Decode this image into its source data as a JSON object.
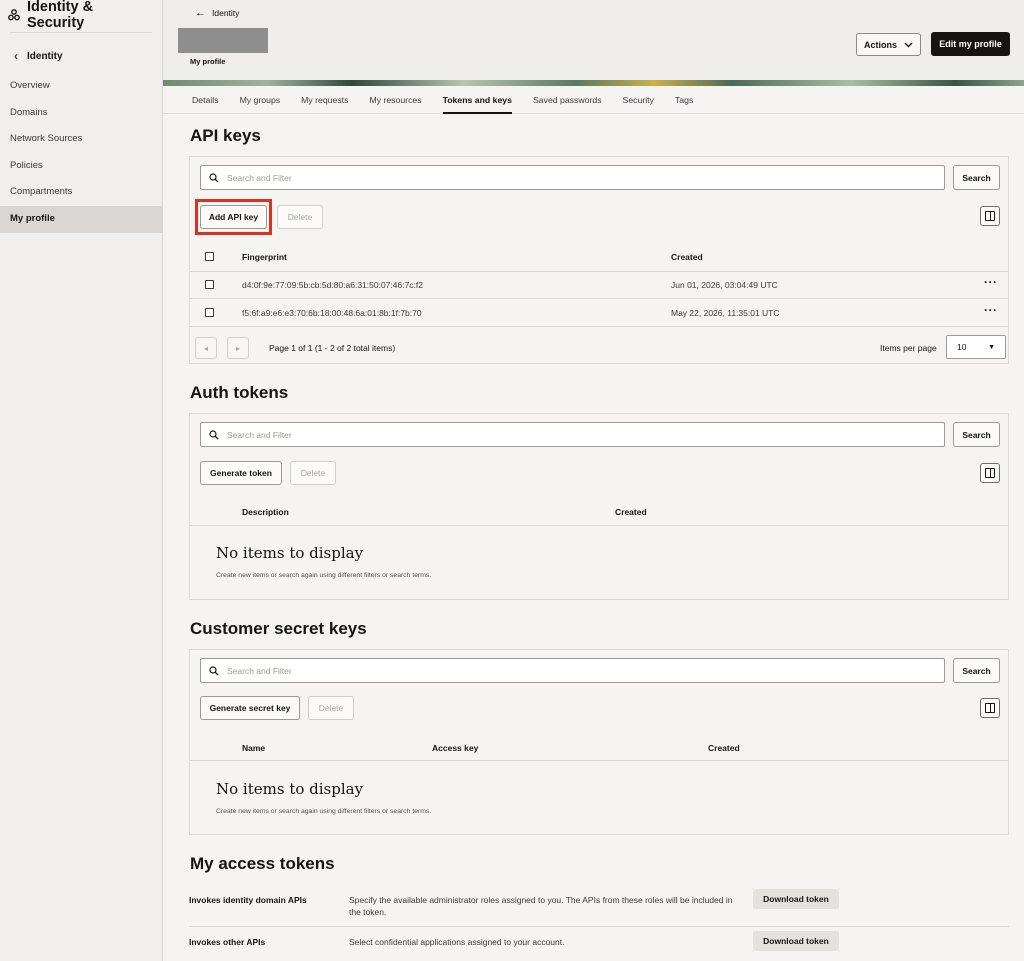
{
  "sidebar": {
    "app_title": "Identity & Security",
    "back_label": "Identity",
    "items": [
      {
        "label": "Overview"
      },
      {
        "label": "Domains"
      },
      {
        "label": "Network Sources"
      },
      {
        "label": "Policies"
      },
      {
        "label": "Compartments"
      },
      {
        "label": "My profile",
        "active": true
      }
    ]
  },
  "header": {
    "back_link": "Identity",
    "profile_label": "My profile",
    "actions_label": "Actions",
    "edit_label": "Edit my profile"
  },
  "tabs": [
    {
      "label": "Details"
    },
    {
      "label": "My groups"
    },
    {
      "label": "My requests"
    },
    {
      "label": "My resources"
    },
    {
      "label": "Tokens and keys",
      "active": true
    },
    {
      "label": "Saved passwords"
    },
    {
      "label": "Security"
    },
    {
      "label": "Tags"
    }
  ],
  "api_keys": {
    "title": "API keys",
    "search_placeholder": "Search and Filter",
    "search_label": "Search",
    "add_label": "Add API key",
    "delete_label": "Delete",
    "columns": {
      "fingerprint": "Fingerprint",
      "created": "Created"
    },
    "rows": [
      {
        "fingerprint": "d4:0f:9e:77:09:5b:cb:5d:80:a6:31:50:07:46:7c:f2",
        "created": "Jun 01, 2026, 03:04:49 UTC"
      },
      {
        "fingerprint": "f5:6f:a9:e6:e3:70:6b:18:00:48:6a:01:8b:1f:7b:70",
        "created": "May 22, 2026, 11:35:01 UTC"
      }
    ],
    "pager_text": "Page 1 of 1 (1 - 2 of 2 total items)",
    "items_per_page_label": "Items per page",
    "items_per_page_value": "10"
  },
  "auth_tokens": {
    "title": "Auth tokens",
    "search_placeholder": "Search and Filter",
    "search_label": "Search",
    "generate_label": "Generate token",
    "delete_label": "Delete",
    "columns": {
      "description": "Description",
      "created": "Created"
    },
    "empty_title": "No items to display",
    "empty_sub": "Create new items or search again using different filters or search terms."
  },
  "secret_keys": {
    "title": "Customer secret keys",
    "search_placeholder": "Search and Filter",
    "search_label": "Search",
    "generate_label": "Generate secret key",
    "delete_label": "Delete",
    "columns": {
      "name": "Name",
      "access_key": "Access key",
      "created": "Created"
    },
    "empty_title": "No items to display",
    "empty_sub": "Create new items or search again using different filters or search terms."
  },
  "access_tokens": {
    "title": "My access tokens",
    "rows": [
      {
        "label": "Invokes identity domain APIs",
        "desc": "Specify the available administrator roles assigned to you. The APIs from these roles will be included in the token.",
        "button": "Download token"
      },
      {
        "label": "Invokes other APIs",
        "desc": "Select confidential applications assigned to your account.",
        "button": "Download token"
      }
    ]
  },
  "colors": {
    "highlight": "#d9331f",
    "primary_button": "#161513"
  }
}
